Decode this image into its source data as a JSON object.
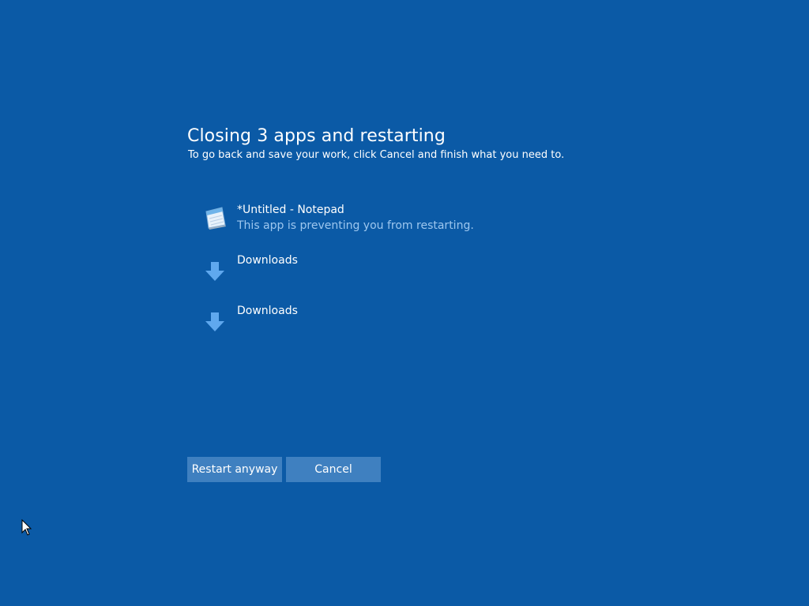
{
  "dialog": {
    "title": "Closing 3 apps and restarting",
    "subtitle": "To go back and save your work, click Cancel and finish what you need to."
  },
  "apps": [
    {
      "name": "*Untitled - Notepad",
      "status": "This app is preventing you from restarting.",
      "icon": "notepad-icon"
    },
    {
      "name": "Downloads",
      "status": "",
      "icon": "download-arrow-icon"
    },
    {
      "name": "Downloads",
      "status": "",
      "icon": "download-arrow-icon"
    }
  ],
  "buttons": {
    "restart_label": "Restart anyway",
    "cancel_label": "Cancel"
  },
  "colors": {
    "background": "#0b5aa6",
    "button": "#3f80c0",
    "status_text": "#9dc7ef",
    "arrow": "#5fa8ee"
  }
}
